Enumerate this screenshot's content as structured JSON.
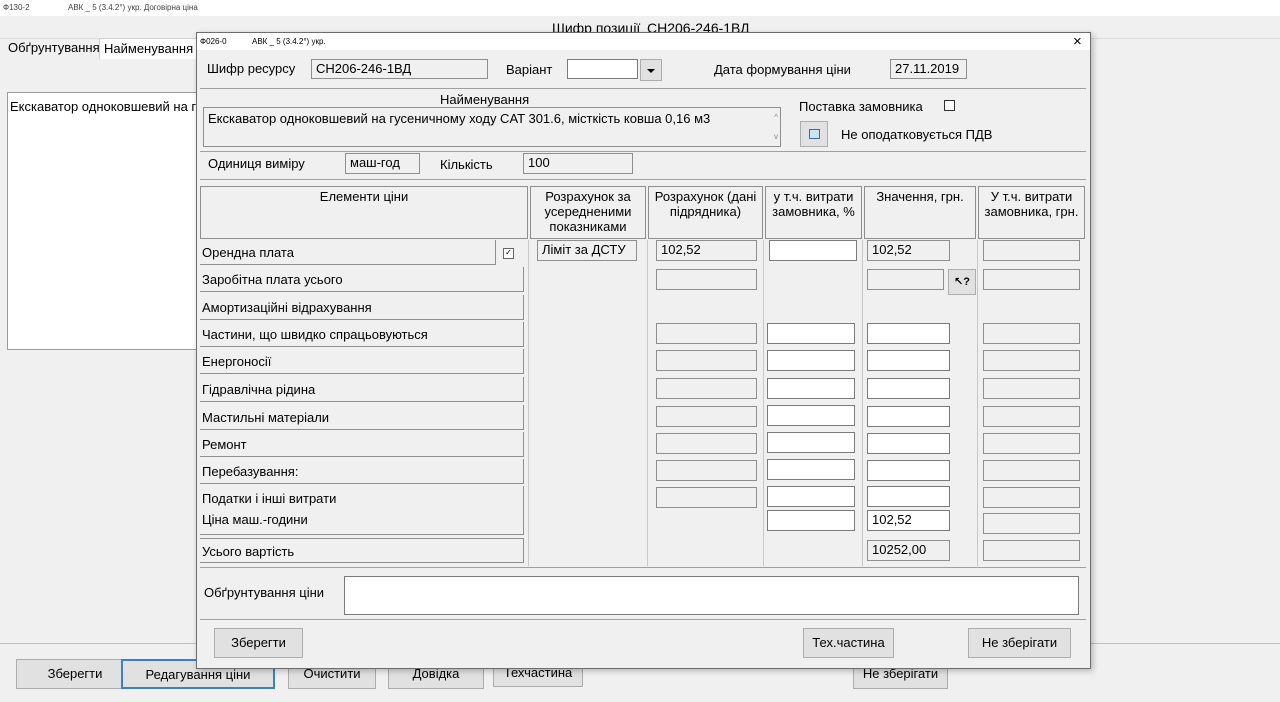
{
  "bg_window": {
    "title_code": "Ф130-2",
    "title_app": "АВК _ 5 (3.4.2°) укр. Договірна ціна",
    "header_label": "Шифр позиції",
    "header_code": "СН206-246-1ВД",
    "tabs": [
      "Обґрунтування",
      "Найменування"
    ],
    "text_preview": "Екскаватор одноковшевий на гу",
    "buttons": [
      "Зберегти",
      "Редагування ціни",
      "Очистити",
      "Довідка",
      "Техчастина",
      "Не зберігати"
    ]
  },
  "dialog": {
    "title_code": "Ф026-0",
    "title_app": "АВК _ 5 (3.4.2°) укр.",
    "close_glyph": "×",
    "resource_code_label": "Шифр ресурсу",
    "resource_code": "СН206-246-1ВД",
    "variant_label": "Варіант",
    "variant_value": "",
    "price_date_label": "Дата формування ціни",
    "price_date": "27.11.2019",
    "name_label": "Найменування",
    "name_value": "Екскаватор одноковшевий на гусеничному ходу CAT 301.6, місткість ковша 0,16 м3",
    "customer_supply_label": "Поставка замовника",
    "vat_label": "Не оподатковується ПДВ",
    "unit_label": "Одиниця виміру",
    "unit_value": "маш-год",
    "qty_label": "Кількість",
    "qty_value": "100",
    "table_headers": [
      "Елементи ціни",
      "Розрахунок за усередненими показниками",
      "Розрахунок (дані підрядника)",
      "у т.ч. витрати замовника, %",
      "Значення, грн.",
      "У т.ч. витрати замовника, грн."
    ],
    "rows": [
      {
        "label": "Орендна плата",
        "avg": "Ліміт за ДСТУ",
        "contractor": "102,52",
        "value": "102,52"
      },
      {
        "label": "Заробітна плата усього",
        "avg": "",
        "contractor": "",
        "value": ""
      },
      {
        "label": "Амортизаційні відрахування",
        "avg": "",
        "contractor": "",
        "value": ""
      },
      {
        "label": "Частини, що швидко спрацьовуються",
        "avg": "",
        "contractor": "",
        "value": ""
      },
      {
        "label": "Енергоносії",
        "avg": "",
        "contractor": "",
        "value": ""
      },
      {
        "label": "Гідравлічна рідина",
        "avg": "",
        "contractor": "",
        "value": ""
      },
      {
        "label": "Мастильні матеріали",
        "avg": "",
        "contractor": "",
        "value": ""
      },
      {
        "label": "Ремонт",
        "avg": "",
        "contractor": "",
        "value": ""
      },
      {
        "label": "Перебазування:",
        "avg": "",
        "contractor": "",
        "value": ""
      },
      {
        "label": "Податки  і інші витрати",
        "avg": "",
        "contractor": "",
        "value": ""
      },
      {
        "label": "Ціна маш.-години",
        "avg": "",
        "contractor": "",
        "value": "102,52"
      },
      {
        "label": "Усього вартість",
        "avg": "",
        "contractor": "",
        "value": "10252,00"
      }
    ],
    "justification_label": "Обґрунтування ціни",
    "justification_value": "",
    "save_label": "Зберегти",
    "techpart_label": "Тех.частина",
    "nosave_label": "Не зберігати"
  }
}
